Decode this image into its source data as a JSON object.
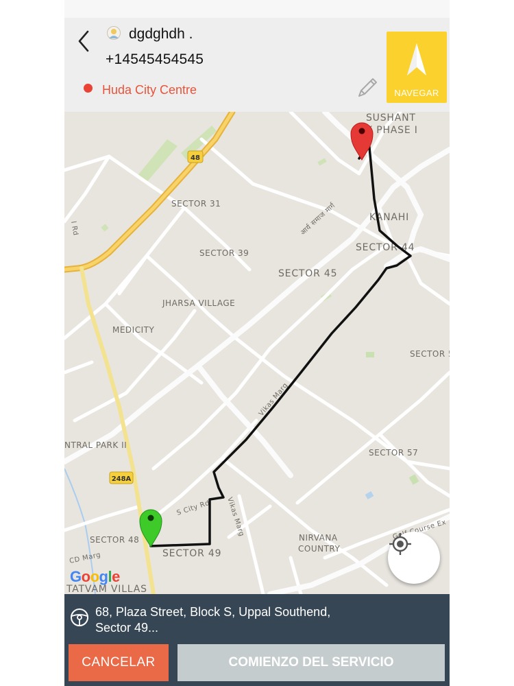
{
  "header": {
    "user_name": "dgdghdh .",
    "phone": "+14545454545",
    "destination": "Huda City Centre",
    "navigate_label": "NAVEGAR"
  },
  "map": {
    "labels": {
      "sushant": "SUSHANT",
      "phase": "K PHASE I",
      "kanahi": "KANAHI",
      "sector44": "SECTOR 44",
      "sector31": "SECTOR 31",
      "sector39": "SECTOR 39",
      "sector45": "SECTOR 45",
      "jharsa": "JHARSA VILLAGE",
      "medicity": "MEDICITY",
      "sector5": "SECTOR 5",
      "park": "NTRAL PARK II",
      "sector57": "SECTOR 57",
      "sector48": "SECTOR 48",
      "sector49": "SECTOR 49",
      "nirvana1": "NIRVANA",
      "nirvana2": "COUNTRY",
      "tatvam": "TATVAM VILLAS",
      "hindi_road": "आर्य समाज मार्ग",
      "vikas_marg1": "Vikas Marg",
      "vikas_marg2": "Vikas Marg",
      "scity": "S City Rd",
      "golf": "Golf Course Ex",
      "cdmarg": "CD Marg",
      "rd": "l Rd",
      "hw48": "48",
      "hw248a": "248A",
      "google": "Google"
    },
    "colors": {
      "route": "#111111",
      "start_pin": "#35c424",
      "end_pin": "#e53935",
      "highway": "#f5c542"
    }
  },
  "address": {
    "line1": "68, Plaza Street, Block S, Uppal Southend,",
    "line2": "Sector 49..."
  },
  "actions": {
    "cancel": "CANCELAR",
    "start": "COMIENZO DEL SERVICIO"
  },
  "icons": {
    "back": "back-arrow-icon",
    "avatar": "avatar-icon",
    "edit": "pencil-icon",
    "navigate": "navigation-arrow-icon",
    "locate": "my-location-icon",
    "steering": "steering-wheel-icon"
  }
}
